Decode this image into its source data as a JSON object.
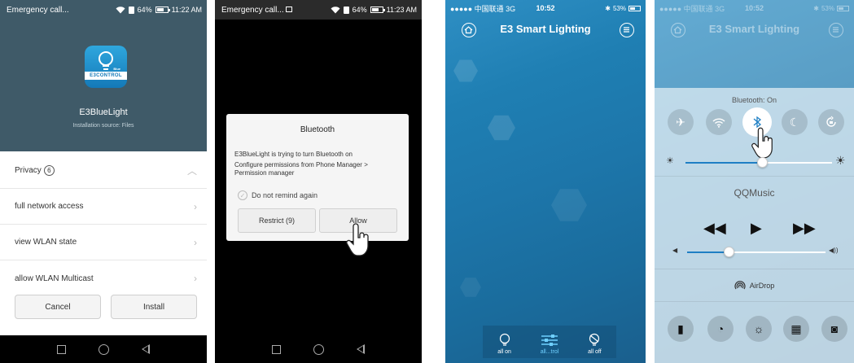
{
  "installer": {
    "status_left": "Emergency call...",
    "status_battery": "64%",
    "status_time": "11:22 AM",
    "app_name": "E3BlueLight",
    "install_source": "Installation source: Files",
    "icon_brand": "E3CONTROL",
    "icon_tag": "Blue",
    "permissions_header": "Privacy",
    "permissions_count": "6",
    "permissions": [
      {
        "label": "full network access"
      },
      {
        "label": "view WLAN state"
      },
      {
        "label": "allow WLAN Multicast"
      }
    ],
    "cancel_label": "Cancel",
    "install_label": "Install"
  },
  "bt_dialog": {
    "status_left": "Emergency call...",
    "status_battery": "64%",
    "status_time": "11:23 AM",
    "title": "Bluetooth",
    "message": "E3BlueLight is trying to turn Bluetooth on",
    "hint": "Configure permissions from Phone Manager > Permission manager",
    "remind_label": "Do not remind again",
    "restrict_label": "Restrict (9)",
    "allow_label": "Allow"
  },
  "lighting_app": {
    "carrier": "●●●●● 中国联通 3G",
    "time": "10:52",
    "battery": "53%",
    "title": "E3 Smart Lighting",
    "tabs": [
      {
        "label": "all on"
      },
      {
        "label": "all...trol"
      },
      {
        "label": "all off"
      }
    ]
  },
  "control_center": {
    "carrier": "●●●●● 中国联通 3G",
    "time": "10:52",
    "battery": "53%",
    "title": "E3 Smart Lighting",
    "bluetooth_status": "Bluetooth: On",
    "brightness_level": 0.52,
    "volume_level": 0.3,
    "music_title": "QQMusic",
    "airdrop_label": "AirDrop",
    "colors": {
      "accent": "#1e7fc4",
      "background": "#1d76aa"
    }
  }
}
